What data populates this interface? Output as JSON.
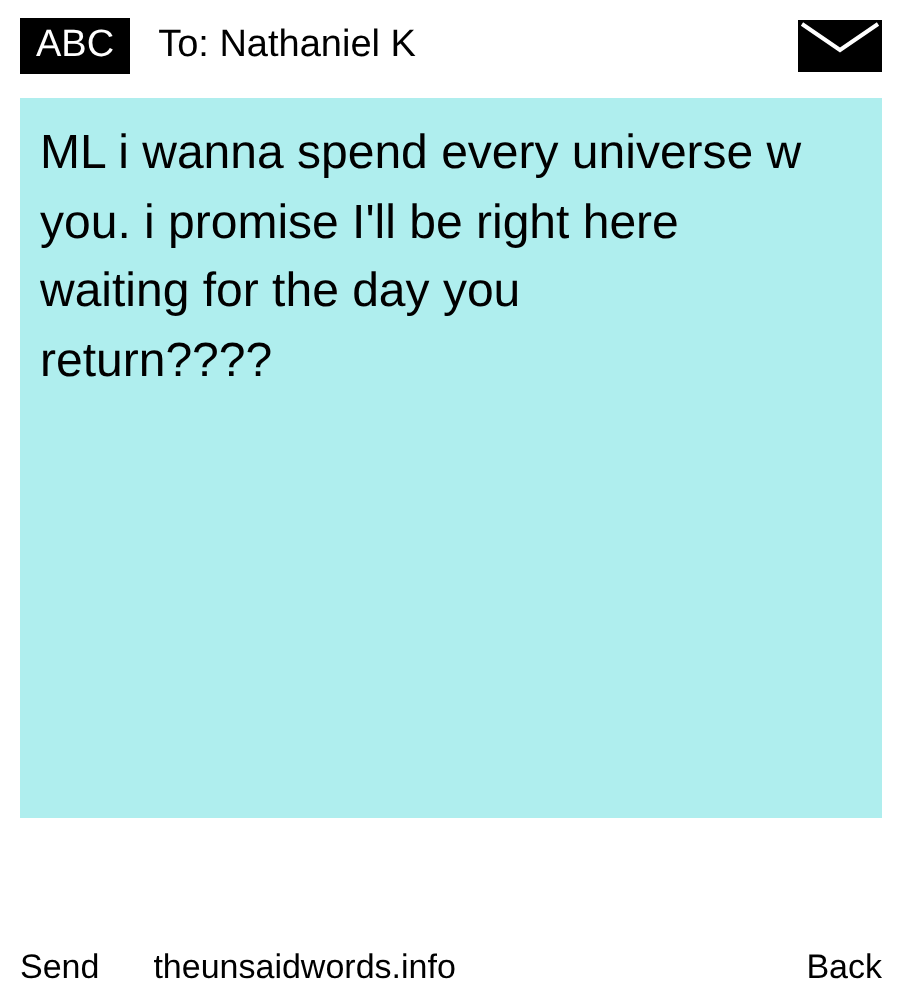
{
  "header": {
    "badge": "ABC",
    "recipient": "To: Nathaniel K"
  },
  "message": {
    "lines": [
      "ML i wanna spend every universe w",
      "you. i promise I'll be right here",
      "waiting for the day you",
      "return????"
    ]
  },
  "footer": {
    "send": "Send",
    "site": "theunsaidwords.info",
    "back": "Back"
  }
}
